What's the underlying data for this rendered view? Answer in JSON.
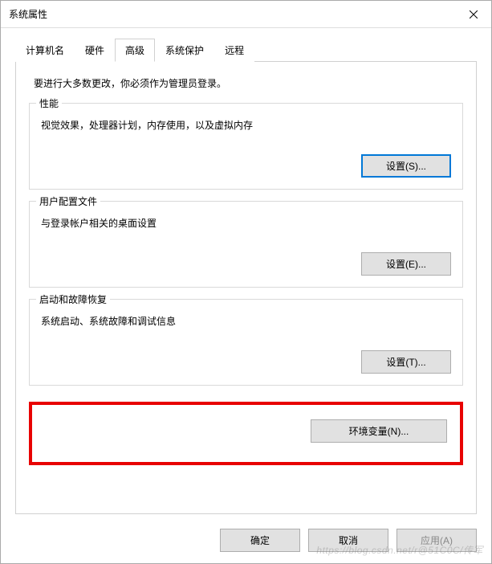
{
  "window": {
    "title": "系统属性"
  },
  "tabs": {
    "computer_name": "计算机名",
    "hardware": "硬件",
    "advanced": "高级",
    "system_protection": "系统保护",
    "remote": "远程"
  },
  "intro": "要进行大多数更改，你必须作为管理员登录。",
  "groups": {
    "performance": {
      "legend": "性能",
      "desc": "视觉效果，处理器计划，内存使用，以及虚拟内存",
      "button": "设置(S)..."
    },
    "user_profiles": {
      "legend": "用户配置文件",
      "desc": "与登录帐户相关的桌面设置",
      "button": "设置(E)..."
    },
    "startup_recovery": {
      "legend": "启动和故障恢复",
      "desc": "系统启动、系统故障和调试信息",
      "button": "设置(T)..."
    }
  },
  "env_button": "环境变量(N)...",
  "dialog_buttons": {
    "ok": "确定",
    "cancel": "取消",
    "apply": "应用(A)"
  },
  "watermark": "https://blog.csdn.net/r@51C0C/传军"
}
